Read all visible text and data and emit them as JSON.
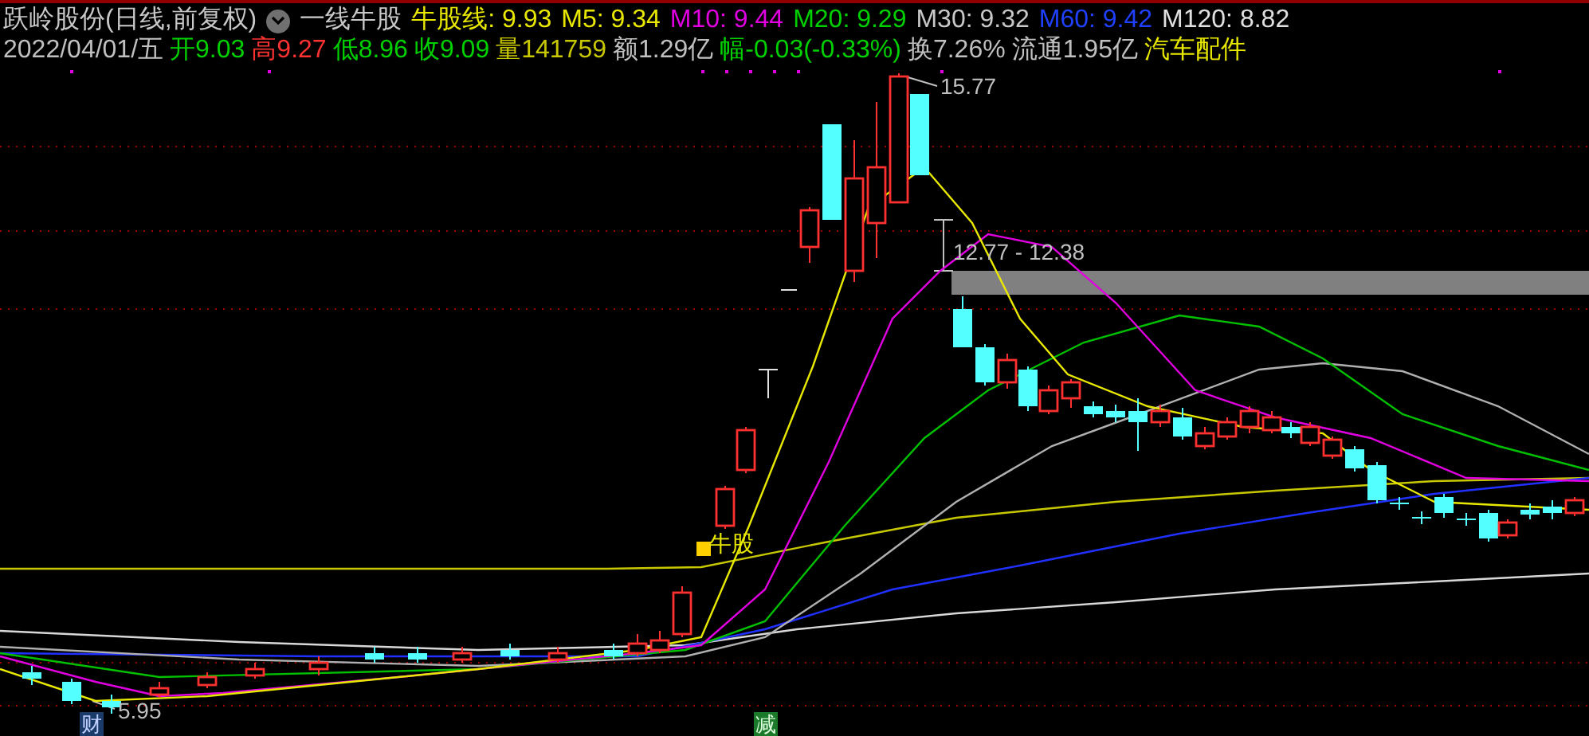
{
  "header": {
    "title": "跃岭股份(日线,前复权)",
    "indicator": "一线牛股",
    "indicator_values": [
      {
        "text": "牛股线: 9.93",
        "color": "#e8e800"
      },
      {
        "text": "M5: 9.34",
        "color": "#e8e800"
      },
      {
        "text": "M10: 9.44",
        "color": "#e000e0"
      },
      {
        "text": "M20: 9.29",
        "color": "#00d000"
      },
      {
        "text": "M30: 9.32",
        "color": "#c8c8c8"
      },
      {
        "text": "M60: 9.42",
        "color": "#2040ff"
      },
      {
        "text": "M120: 8.82",
        "color": "#e0e0e0"
      }
    ],
    "quote": [
      {
        "text": "2022/04/01/五",
        "color": "#c0c0c0"
      },
      {
        "text": "开9.03",
        "color": "#00d000"
      },
      {
        "text": "高9.27",
        "color": "#ff3232"
      },
      {
        "text": "低8.96",
        "color": "#00d000"
      },
      {
        "text": "收9.09",
        "color": "#00d000"
      },
      {
        "text": "量141759",
        "color": "#c8c800"
      },
      {
        "text": "额1.29亿",
        "color": "#c0c0c0"
      },
      {
        "text": "幅-0.03(-0.33%)",
        "color": "#00d000"
      },
      {
        "text": "换7.26%",
        "color": "#c0c0c0"
      },
      {
        "text": "流通1.95亿",
        "color": "#c0c0c0"
      },
      {
        "text": "汽车配件",
        "color": "#e8e800"
      }
    ]
  },
  "chart": {
    "high_label": "15.77",
    "low_label": "5.95",
    "range_label": "12.77 - 12.38",
    "signal_label": "牛股",
    "markers": [
      {
        "text": "财",
        "color": "#1a3a6a"
      },
      {
        "text": "减",
        "color": "#1a7a2a"
      }
    ]
  }
}
